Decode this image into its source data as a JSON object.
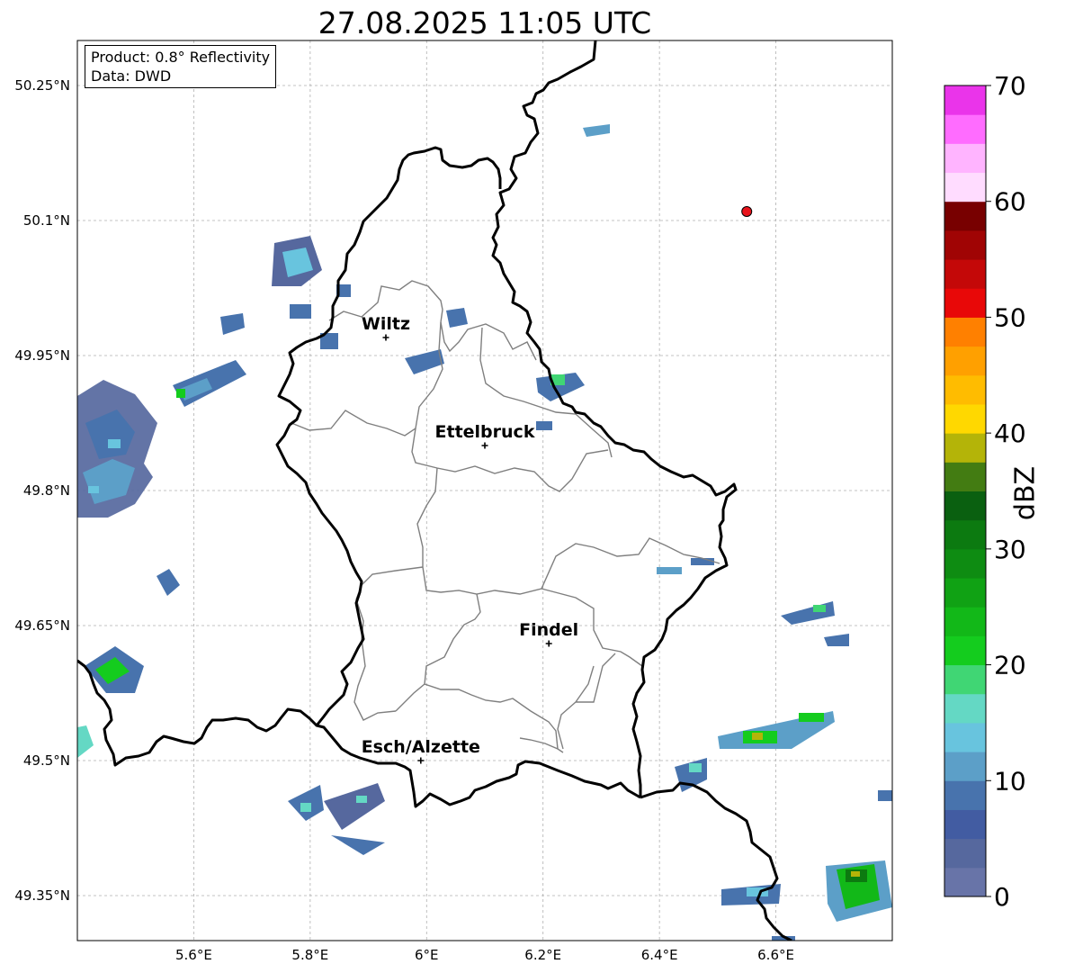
{
  "title": "27.08.2025 11:05 UTC",
  "info": {
    "product": "Product: 0.8° Reflectivity",
    "data": "Data: DWD"
  },
  "map": {
    "lon_range": [
      5.4,
      6.8
    ],
    "lat_range": [
      49.3,
      50.3
    ],
    "lat_ticks": [
      {
        "value": 50.25,
        "label": "50.25°N"
      },
      {
        "value": 50.1,
        "label": "50.1°N"
      },
      {
        "value": 49.95,
        "label": "49.95°N"
      },
      {
        "value": 49.8,
        "label": "49.8°N"
      },
      {
        "value": 49.65,
        "label": "49.65°N"
      },
      {
        "value": 49.5,
        "label": "49.5°N"
      },
      {
        "value": 49.35,
        "label": "49.35°N"
      }
    ],
    "lon_ticks": [
      {
        "value": 5.6,
        "label": "5.6°E"
      },
      {
        "value": 5.8,
        "label": "5.8°E"
      },
      {
        "value": 6.0,
        "label": "6°E"
      },
      {
        "value": 6.2,
        "label": "6.2°E"
      },
      {
        "value": 6.4,
        "label": "6.4°E"
      },
      {
        "value": 6.6,
        "label": "6.6°E"
      }
    ],
    "grid": true,
    "cities": [
      {
        "name": "Wiltz",
        "lon": 5.93,
        "lat": 49.97
      },
      {
        "name": "Ettelbruck",
        "lon": 6.1,
        "lat": 49.85
      },
      {
        "name": "Findel",
        "lon": 6.21,
        "lat": 49.63
      },
      {
        "name": "Esch/Alzette",
        "lon": 5.99,
        "lat": 49.5
      }
    ],
    "radar_site": {
      "lon": 6.55,
      "lat": 50.11,
      "color": "#e8141c"
    }
  },
  "colorbar": {
    "label": "dBZ",
    "min": 0,
    "max": 70,
    "step": 2.5,
    "tick_labels": [
      "0",
      "10",
      "20",
      "30",
      "40",
      "50",
      "60",
      "70"
    ],
    "colors": [
      "#6874a8",
      "#56689e",
      "#425ca2",
      "#4873ad",
      "#5c9fc8",
      "#68c4de",
      "#64d8c4",
      "#40d674",
      "#14cc1e",
      "#12b818",
      "#10a214",
      "#0e8c12",
      "#0c7a10",
      "#0a6010",
      "#437c12",
      "#b4b408",
      "#ffd800",
      "#ffbc00",
      "#ffa000",
      "#ff8000",
      "#e80808",
      "#c40808",
      "#a00404",
      "#780000",
      "#ffdcff",
      "#ffb4ff",
      "#ff6cff",
      "#ea34ea"
    ]
  }
}
